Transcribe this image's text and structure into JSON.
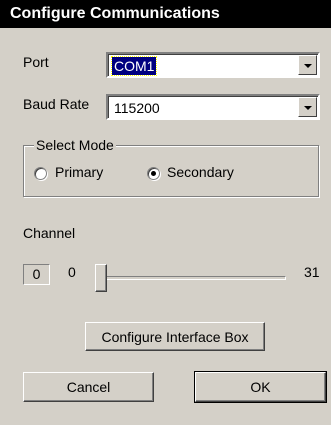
{
  "window": {
    "title": "Configure Communications"
  },
  "port": {
    "label": "Port",
    "value": "COM1"
  },
  "baud": {
    "label": "Baud Rate",
    "value": "115200"
  },
  "mode": {
    "legend": "Select Mode",
    "primary_label": "Primary",
    "secondary_label": "Secondary",
    "selected": "Secondary"
  },
  "channel": {
    "label": "Channel",
    "value": "0",
    "min_label": "0",
    "max_label": "31",
    "slider_value": 0
  },
  "buttons": {
    "configure_label": "Configure Interface Box",
    "cancel_label": "Cancel",
    "ok_label": "OK"
  }
}
